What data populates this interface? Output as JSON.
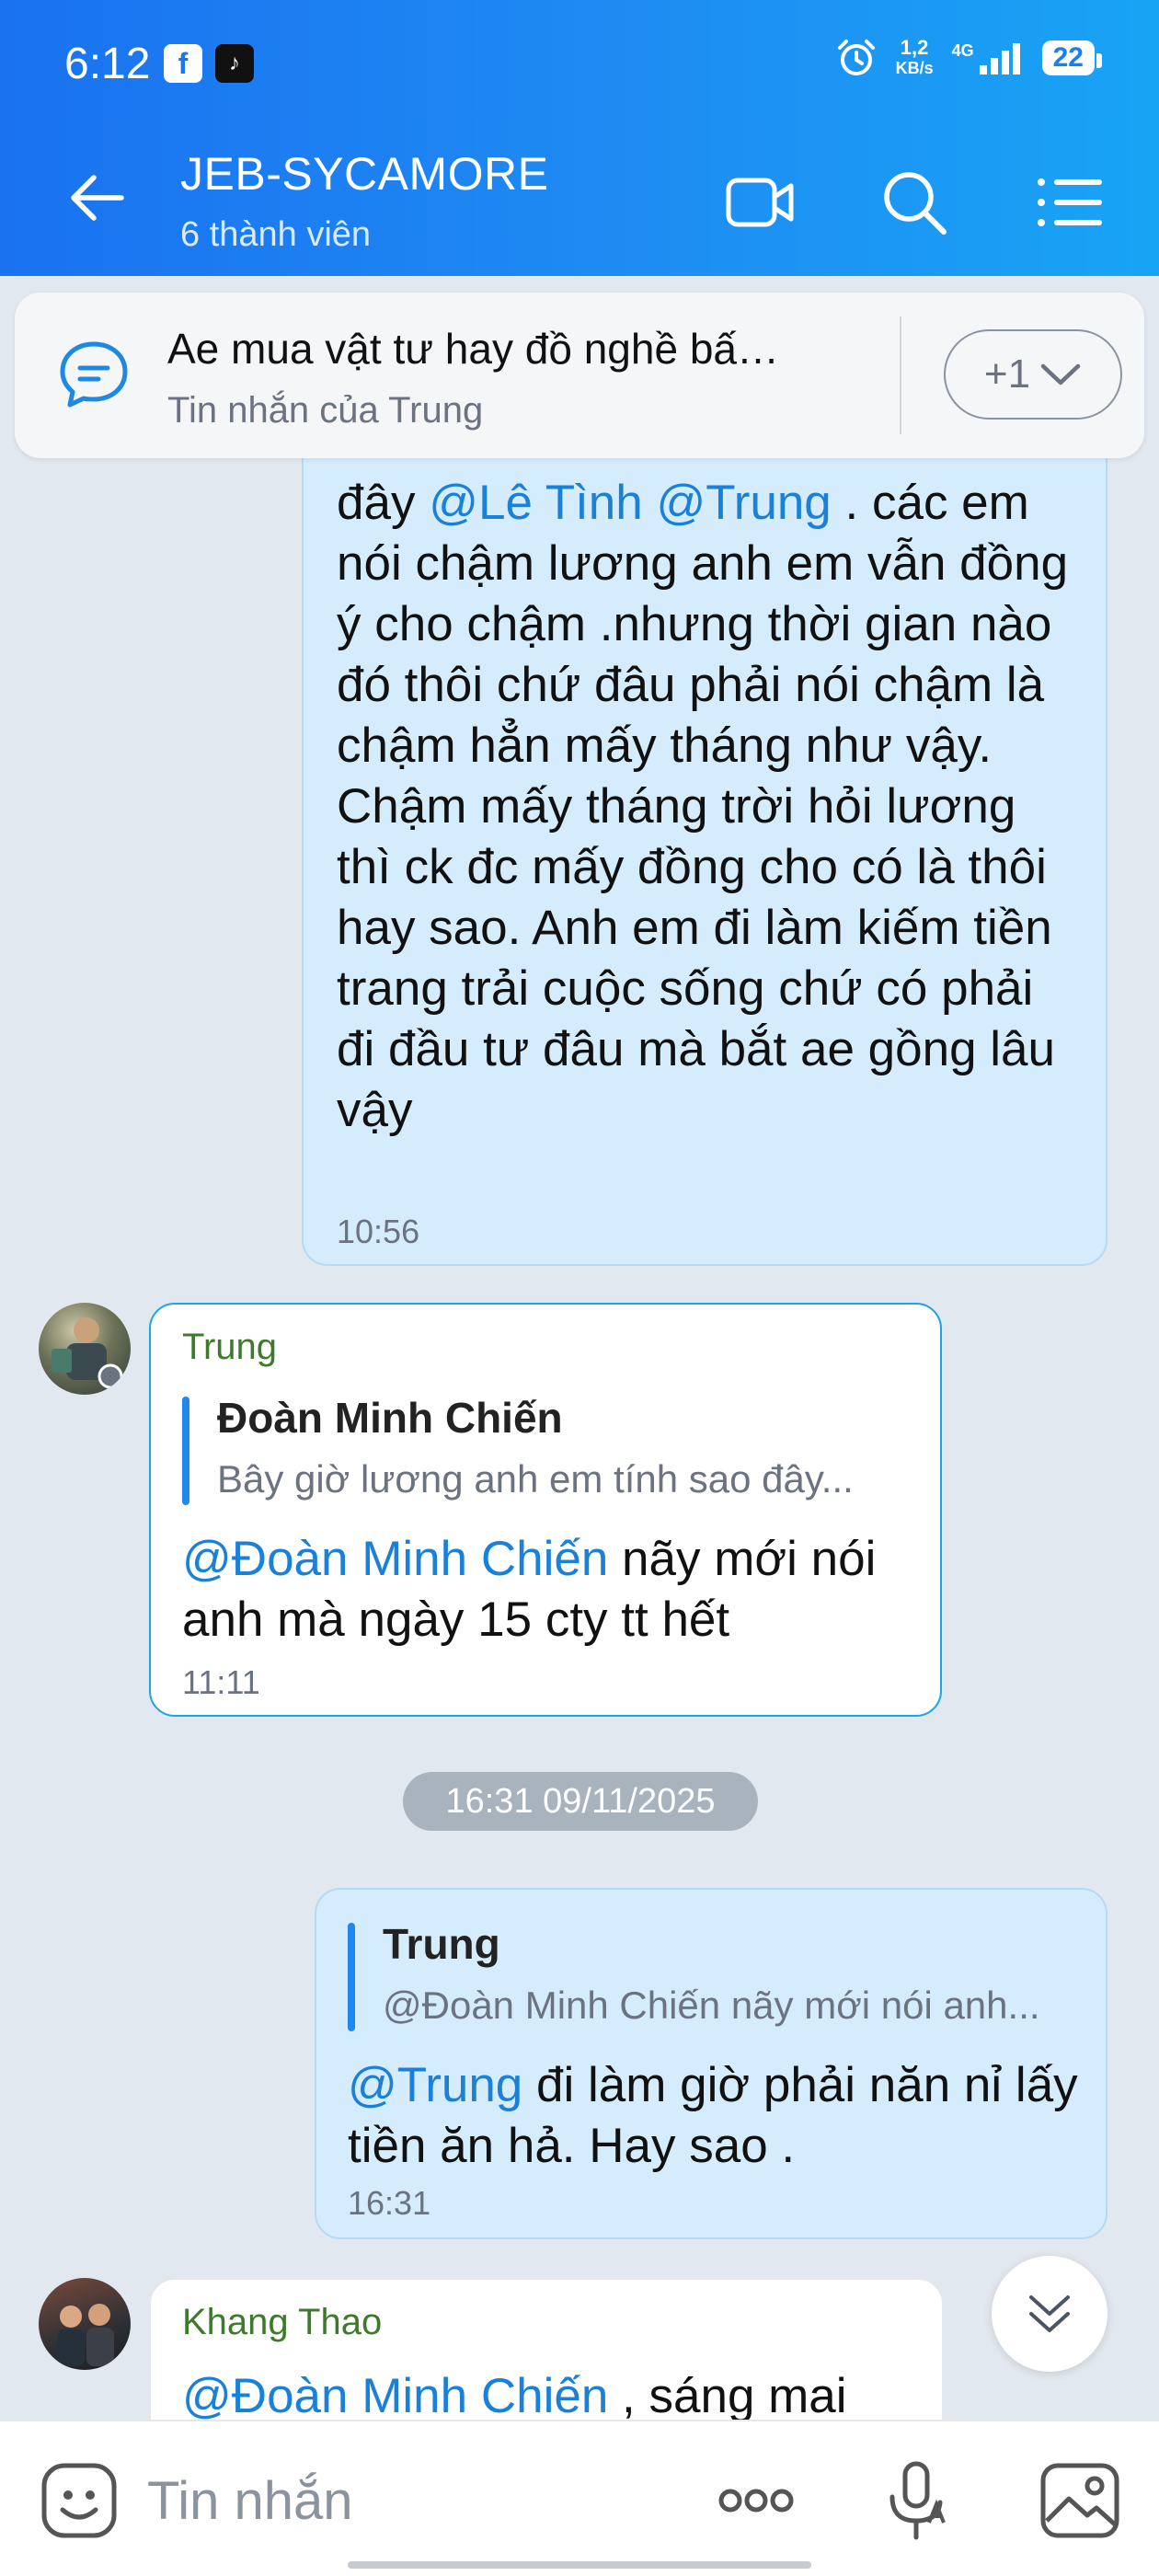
{
  "status_bar": {
    "time": "6:12",
    "net_speed_value": "1,2",
    "net_speed_unit": "KB/s",
    "network": "4G",
    "battery": "22"
  },
  "header": {
    "title": "JEB-SYCAMORE",
    "subtitle": "6 thành viên"
  },
  "pinned": {
    "title": "Ae mua vật tư hay đồ nghề bấ…",
    "subtitle": "Tin nhắn của Trung",
    "more": "+1"
  },
  "messages": {
    "m1": {
      "line1_prefix": "đây ",
      "mention1": "@Lê Tình",
      "mention2": "@Trung",
      "line1_suffix": "  . các em",
      "body": "nói chậm lương anh em vẫn đồng ý cho chậm .nhưng thời gian nào đó thôi chứ đâu phải nói chậm là chậm hẳn mấy tháng như vậy. Chậm mấy tháng trời hỏi lương thì ck đc mấy đồng cho có là thôi hay sao. Anh em đi làm kiếm tiền trang trải cuộc sống chứ có phải đi đầu tư đâu mà bắt ae gồng lâu vậy",
      "time": "10:56"
    },
    "m2": {
      "sender": "Trung",
      "quote_name": "Đoàn Minh Chiến",
      "quote_text": "Bây giờ lương anh em tính sao đây...",
      "mention": "@Đoàn Minh Chiến",
      "text": " nãy mới nói anh mà ngày 15 cty tt hết",
      "time": "11:11"
    },
    "date_separator": "16:31 09/11/2025",
    "m3": {
      "quote_name": "Trung",
      "quote_text": "@Đoàn Minh Chiến nãy mới nói anh...",
      "mention": "@Trung",
      "text": "  đi làm giờ phải năn nỉ lấy tiền ăn hả. Hay sao .",
      "time": "16:31"
    },
    "m4": {
      "sender": "Khang Thao",
      "mention": "@Đoàn Minh Chiến",
      "text": "  , sáng mai"
    }
  },
  "input": {
    "placeholder": "Tin nhắn"
  },
  "colors": {
    "header_start": "#1a72f0",
    "header_end": "#18a4f5",
    "my_bubble": "#d5ecfc",
    "mention": "#1a80d8",
    "sender_name": "#3f7a2c"
  }
}
